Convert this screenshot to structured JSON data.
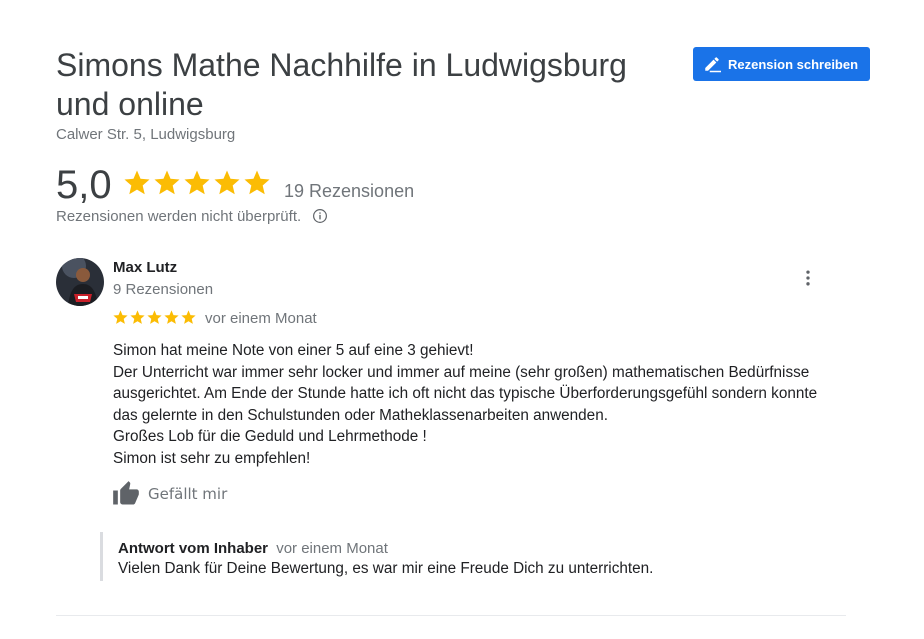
{
  "place": {
    "title": "Simons Mathe Nachhilfe in Ludwigsburg und online",
    "address": "Calwer Str. 5, Ludwigsburg"
  },
  "actions": {
    "write_review_label": "Rezension schreiben",
    "write_review_icon": "pencil-icon"
  },
  "summary": {
    "rating": "5,0",
    "stars": 5,
    "review_count": "19 Rezensionen",
    "notice": "Rezensionen werden nicht überprüft.",
    "notice_icon": "info-icon",
    "star_color": "#fbbc04"
  },
  "review": {
    "author": "Max Lutz",
    "author_reviews": "9 Rezensionen",
    "stars": 5,
    "date": "vor einem Monat",
    "lines": [
      "Simon hat meine Note von einer 5 auf eine 3 gehievt!",
      "Der Unterricht war immer sehr locker und immer auf meine (sehr großen) mathematischen Bedürfnisse ausgerichtet. Am Ende der Stunde hatte ich oft nicht das typische Überforderungsgefühl sondern konnte das gelernte in den Schulstunden oder Matheklassenarbeiten anwenden.",
      "Großes Lob für die Geduld und Lehrmethode !",
      "Simon ist sehr zu empfehlen!"
    ],
    "like_label": "Gefällt mir",
    "like_icon": "thumbs-up-icon",
    "menu_icon": "more-vert-icon"
  },
  "owner_reply": {
    "label": "Antwort vom Inhaber",
    "date": "vor einem Monat",
    "text": "Vielen Dank für Deine Bewertung, es war mir eine Freude Dich zu unterrichten."
  },
  "colors": {
    "accent": "#1a73e8",
    "secondary_text": "#70757a"
  }
}
